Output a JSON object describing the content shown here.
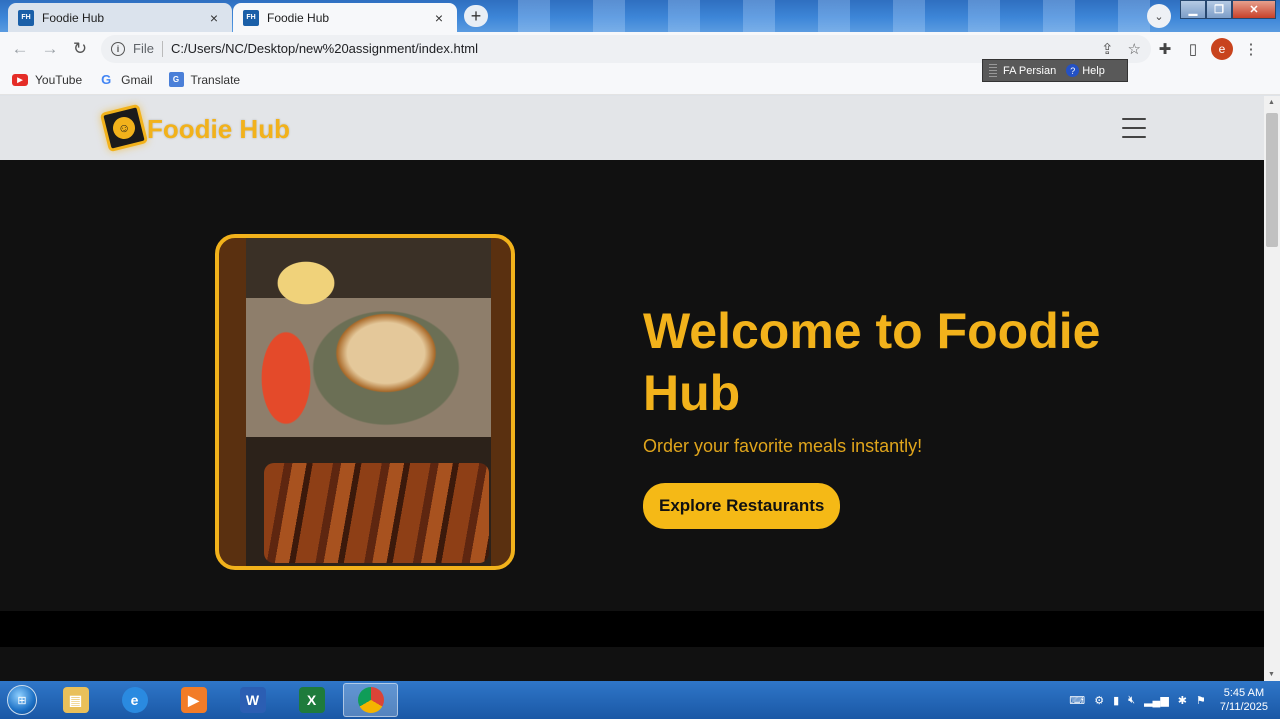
{
  "browser": {
    "tabs": [
      {
        "favicon": "FH",
        "title": "Foodie Hub",
        "close": "×"
      },
      {
        "favicon": "FH",
        "title": "Foodie Hub",
        "close": "×"
      }
    ],
    "new_tab": "+",
    "address": {
      "scheme_label": "File",
      "url": "C:/Users/NC/Desktop/new%20assignment/index.html"
    },
    "bookmarks": [
      {
        "label": "YouTube",
        "icon": "youtube-icon"
      },
      {
        "label": "Gmail",
        "icon": "google-icon"
      },
      {
        "label": "Translate",
        "icon": "translate-icon"
      }
    ],
    "profile_initial": "e"
  },
  "language_bar": {
    "language": "FA Persian",
    "help": "Help"
  },
  "site": {
    "brand": "Foodie Hub",
    "hero": {
      "title": "Welcome to Foodie Hub",
      "subtitle": "Order your favorite meals instantly!",
      "cta": "Explore Restaurants"
    }
  },
  "taskbar": {
    "time": "5:45 AM",
    "date": "7/11/2025"
  },
  "colors": {
    "accent": "#f2b21b",
    "hero_bg": "#111111",
    "header_bg": "#e3e5e8"
  }
}
